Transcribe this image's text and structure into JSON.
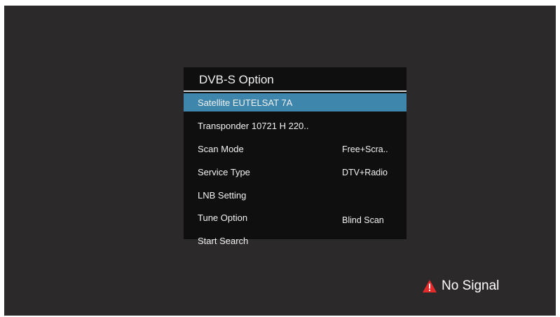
{
  "menu": {
    "title": "DVB-S Option",
    "items": [
      {
        "label": "Satellite EUTELSAT 7A",
        "value": ""
      },
      {
        "label": "Transponder 10721 H 220..",
        "value": ""
      },
      {
        "label": "Scan Mode",
        "value": "Free+Scra.."
      },
      {
        "label": "Service Type",
        "value": "DTV+Radio"
      },
      {
        "label": "LNB Setting",
        "value": ""
      },
      {
        "label": "Tune Option",
        "value": "Blind Scan"
      },
      {
        "label": "Start Search",
        "value": ""
      }
    ]
  },
  "status": {
    "text": "No Signal",
    "icon": "warning-triangle-icon",
    "icon_color": "#e32b2b"
  },
  "colors": {
    "background": "#2b2929",
    "menu_background": "#0f0f0f",
    "highlight": "#3f86ac"
  }
}
